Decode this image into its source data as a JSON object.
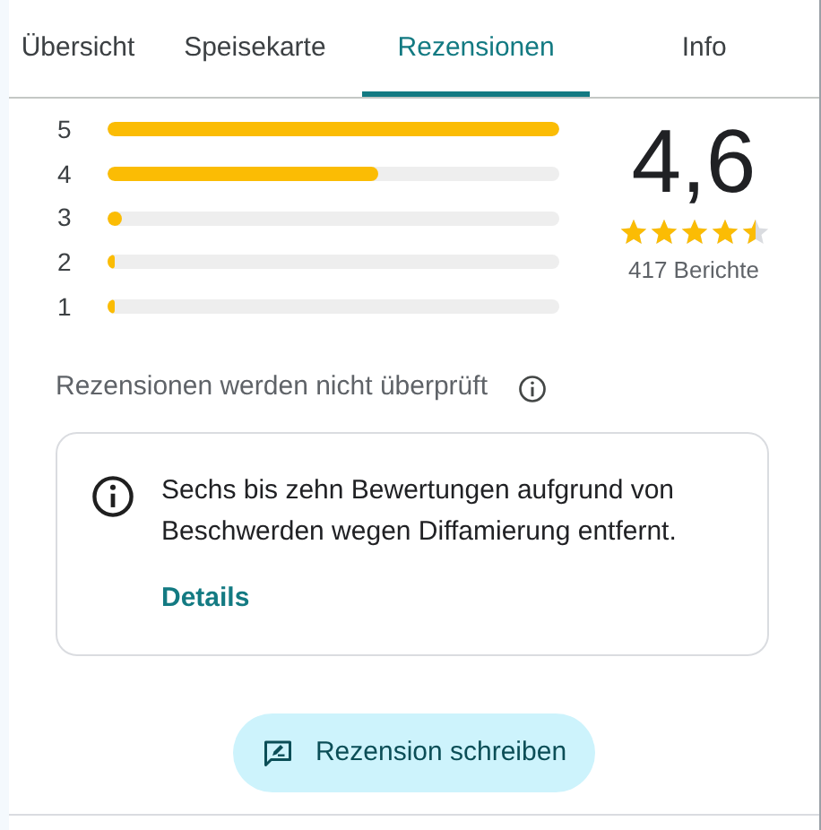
{
  "tabs": [
    {
      "label": "Übersicht",
      "selected": false
    },
    {
      "label": "Speisekarte",
      "selected": false
    },
    {
      "label": "Rezensionen",
      "selected": true
    },
    {
      "label": "Info",
      "selected": false
    }
  ],
  "histogram": [
    {
      "label": "5",
      "level": 1
    },
    {
      "label": "4",
      "level": 0.6
    },
    {
      "label": "3",
      "level": 0.03
    },
    {
      "label": "2",
      "level": 0.012
    },
    {
      "label": "1",
      "level": 0.008
    }
  ],
  "rating": {
    "value": "4,6",
    "stars": 4.5,
    "count": "417 Berichte"
  },
  "notice": "Rezensionen werden nicht überprüft",
  "info_card": {
    "text": "Sechs bis zehn Bewertungen aufgrund von Beschwerden wegen Diffamierung entfernt.",
    "link": "Details"
  },
  "write_button": "Rezension schreiben"
}
